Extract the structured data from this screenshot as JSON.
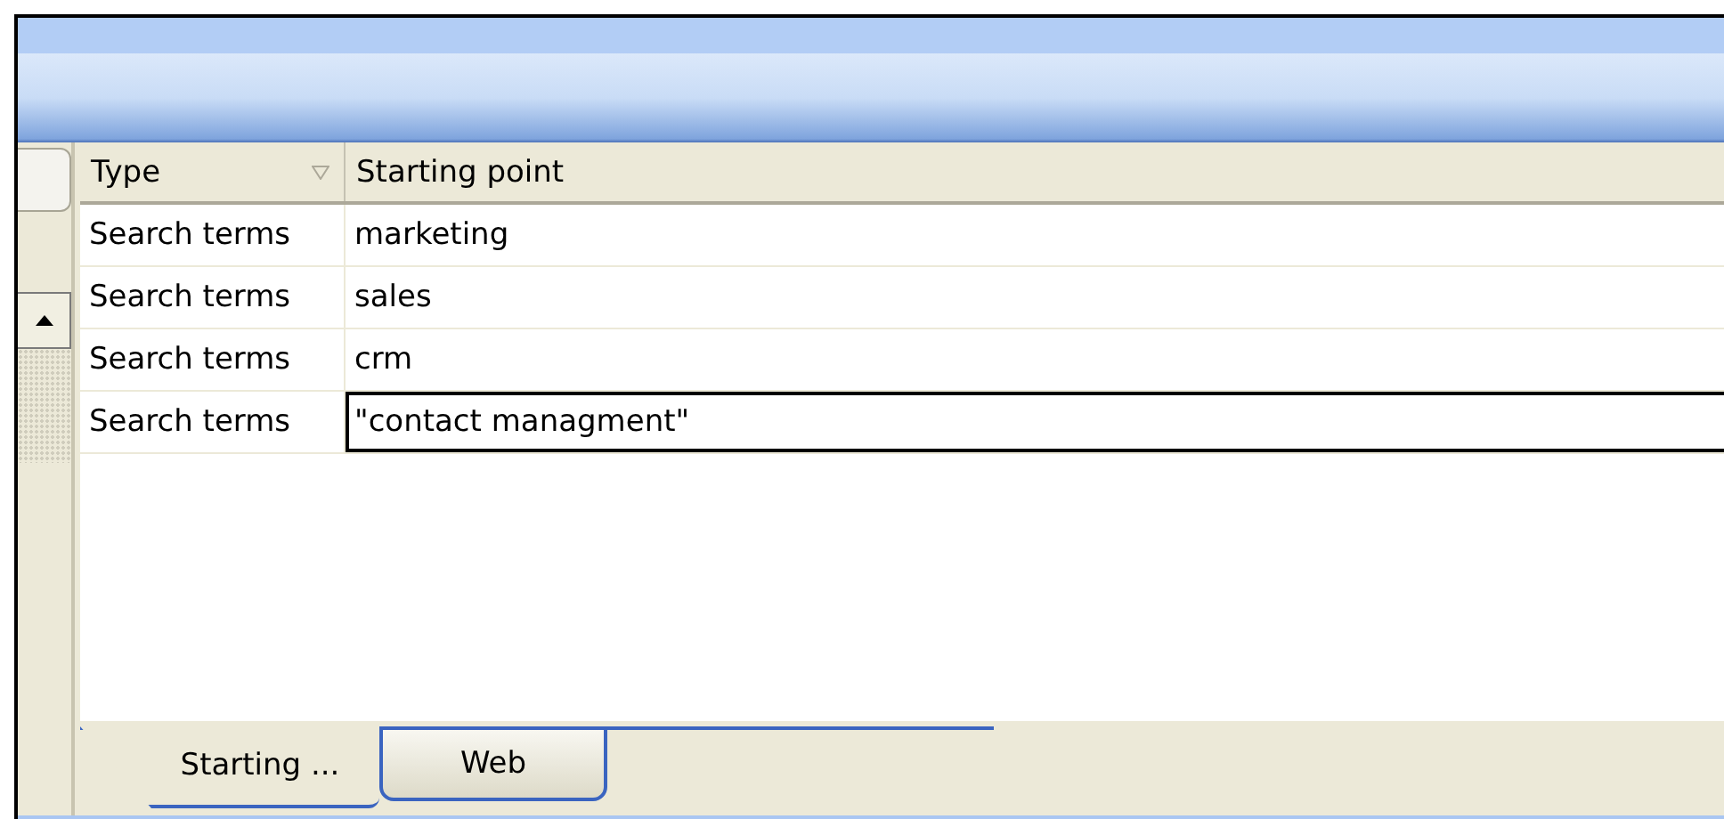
{
  "table": {
    "columns": [
      {
        "label": "Type",
        "sorted": true
      },
      {
        "label": "Starting point"
      }
    ],
    "rows": [
      {
        "type": "Search terms",
        "starting_point": "marketing",
        "editing": false
      },
      {
        "type": "Search terms",
        "starting_point": "sales",
        "editing": false
      },
      {
        "type": "Search terms",
        "starting_point": "crm",
        "editing": false
      },
      {
        "type": "Search terms",
        "starting_point": "\"contact managment\"",
        "editing": true
      }
    ]
  },
  "tabs": [
    {
      "label": "Starting ...",
      "selected": true
    },
    {
      "label": "Web",
      "selected": false
    }
  ]
}
